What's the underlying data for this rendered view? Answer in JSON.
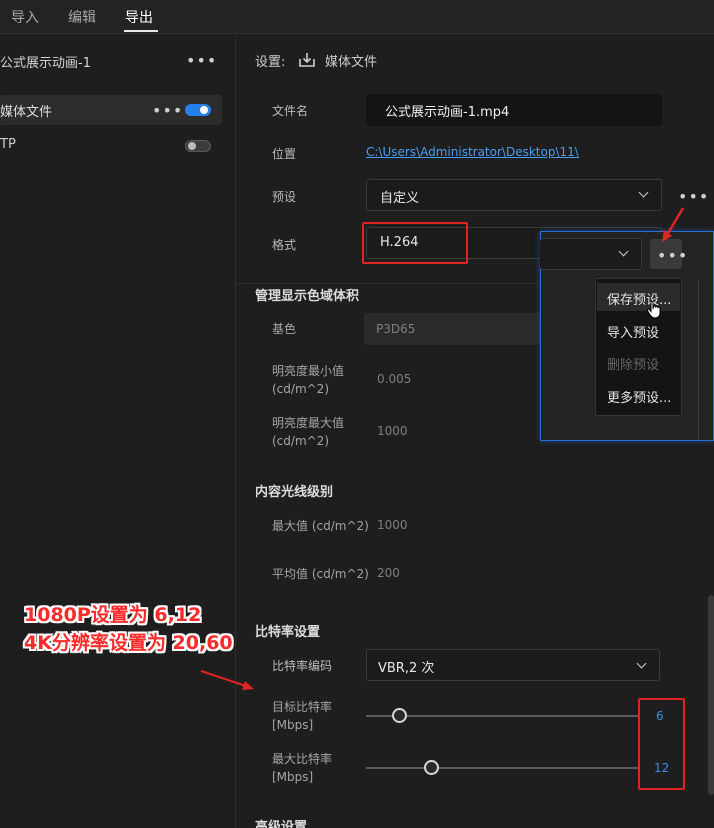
{
  "tabs": [
    {
      "label": "导入",
      "active": false
    },
    {
      "label": "编辑",
      "active": false
    },
    {
      "label": "导出",
      "active": true
    }
  ],
  "left_panel": {
    "sequence_title": "公式展示动画-1",
    "destinations": [
      {
        "label": "媒体文件",
        "enabled": true
      },
      {
        "label": "TP",
        "enabled": false
      }
    ]
  },
  "settings": {
    "heading": "设置:",
    "target": "媒体文件",
    "file_name_label": "文件名",
    "file_name_value": "公式展示动画-1.mp4",
    "location_label": "位置",
    "location_value": "C:\\Users\\Administrator\\Desktop\\11\\",
    "preset_label": "预设",
    "preset_value": "自定义",
    "format_label": "格式",
    "format_value": "H.264"
  },
  "color_gamut": {
    "section": "管理显示色域体积",
    "primaries_label": "基色",
    "primaries_value": "P3D65",
    "min_lum_label_line1": "明亮度最小值",
    "min_lum_label_line2": "(cd/m^2)",
    "min_lum_value": "0.005",
    "max_lum_label_line1": "明亮度最大值",
    "max_lum_label_line2": "(cd/m^2)",
    "max_lum_value": "1000"
  },
  "light_level": {
    "section": "内容光线级别",
    "max_label": "最大值 (cd/m^2)",
    "max_value": "1000",
    "avg_label": "平均值 (cd/m^2)",
    "avg_value": "200"
  },
  "bitrate": {
    "section": "比特率设置",
    "encoding_label": "比特率编码",
    "encoding_value": "VBR,2 次",
    "target_label_line1": "目标比特率",
    "target_label_line2": "[Mbps]",
    "target_value": "6",
    "target_level": 0.12,
    "max_label_line1": "最大比特率",
    "max_label_line2": "[Mbps]",
    "max_value": "12",
    "max_level": 0.24
  },
  "advanced_section": "高级设置",
  "preset_menu": {
    "items": [
      {
        "label": "保存预设...",
        "disabled": false
      },
      {
        "label": "导入预设",
        "disabled": false
      },
      {
        "label": "删除预设",
        "disabled": true
      },
      {
        "label": "更多预设...",
        "disabled": false
      }
    ]
  },
  "annotation": {
    "line1": "1080P设置为 6,12",
    "line2": "4K分辨率设置为 20,60"
  },
  "colors": {
    "accent": "#2680eb",
    "link": "#4a9cf0",
    "annotation_red": "#e02424",
    "value_blue": "#3a8ee6"
  },
  "icons": [
    "more-dots-icon",
    "toggle-icon",
    "export-icon",
    "chevron-down-icon",
    "cursor-icon",
    "red-arrow-icon"
  ]
}
